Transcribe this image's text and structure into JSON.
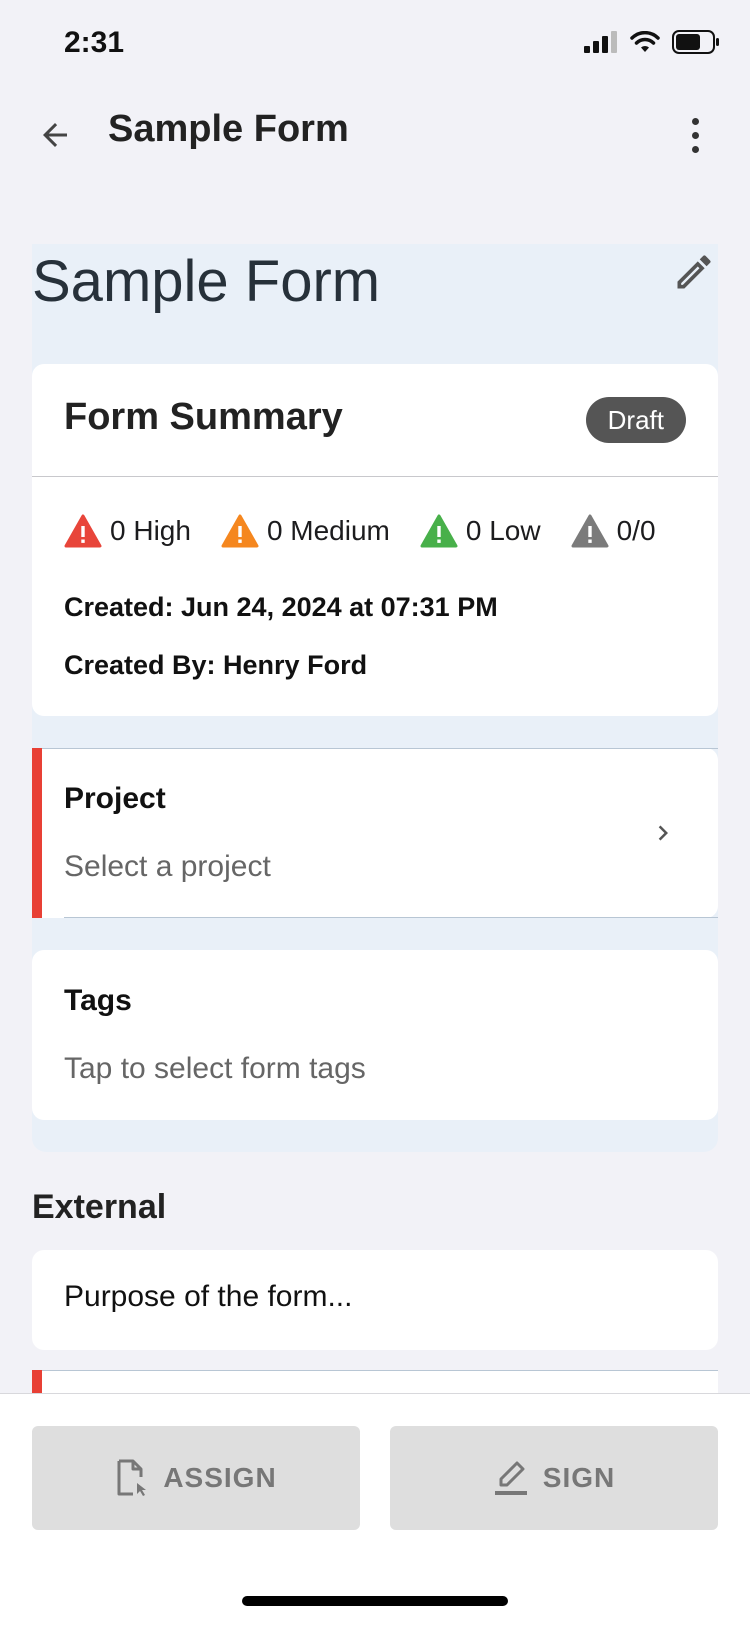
{
  "status_bar": {
    "time": "2:31"
  },
  "nav": {
    "title": "Sample Form"
  },
  "form": {
    "title": "Sample Form"
  },
  "summary": {
    "title": "Form Summary",
    "status_badge": "Draft",
    "counts": {
      "high": "0 High",
      "medium": "0 Medium",
      "low": "0 Low",
      "other": "0/0"
    },
    "created": "Created: Jun 24, 2024 at 07:31 PM",
    "created_by": "Created By: Henry Ford"
  },
  "project": {
    "label": "Project",
    "value": "Select a project"
  },
  "tags": {
    "label": "Tags",
    "value": "Tap to select form tags"
  },
  "external": {
    "title": "External",
    "placeholder": "Purpose of the form..."
  },
  "actions": {
    "assign": "ASSIGN",
    "sign": "SIGN"
  },
  "colors": {
    "high": "#e8453a",
    "medium": "#f5871f",
    "low": "#48b04a",
    "neutral": "#7b7b7b",
    "required_accent": "#e84035"
  }
}
